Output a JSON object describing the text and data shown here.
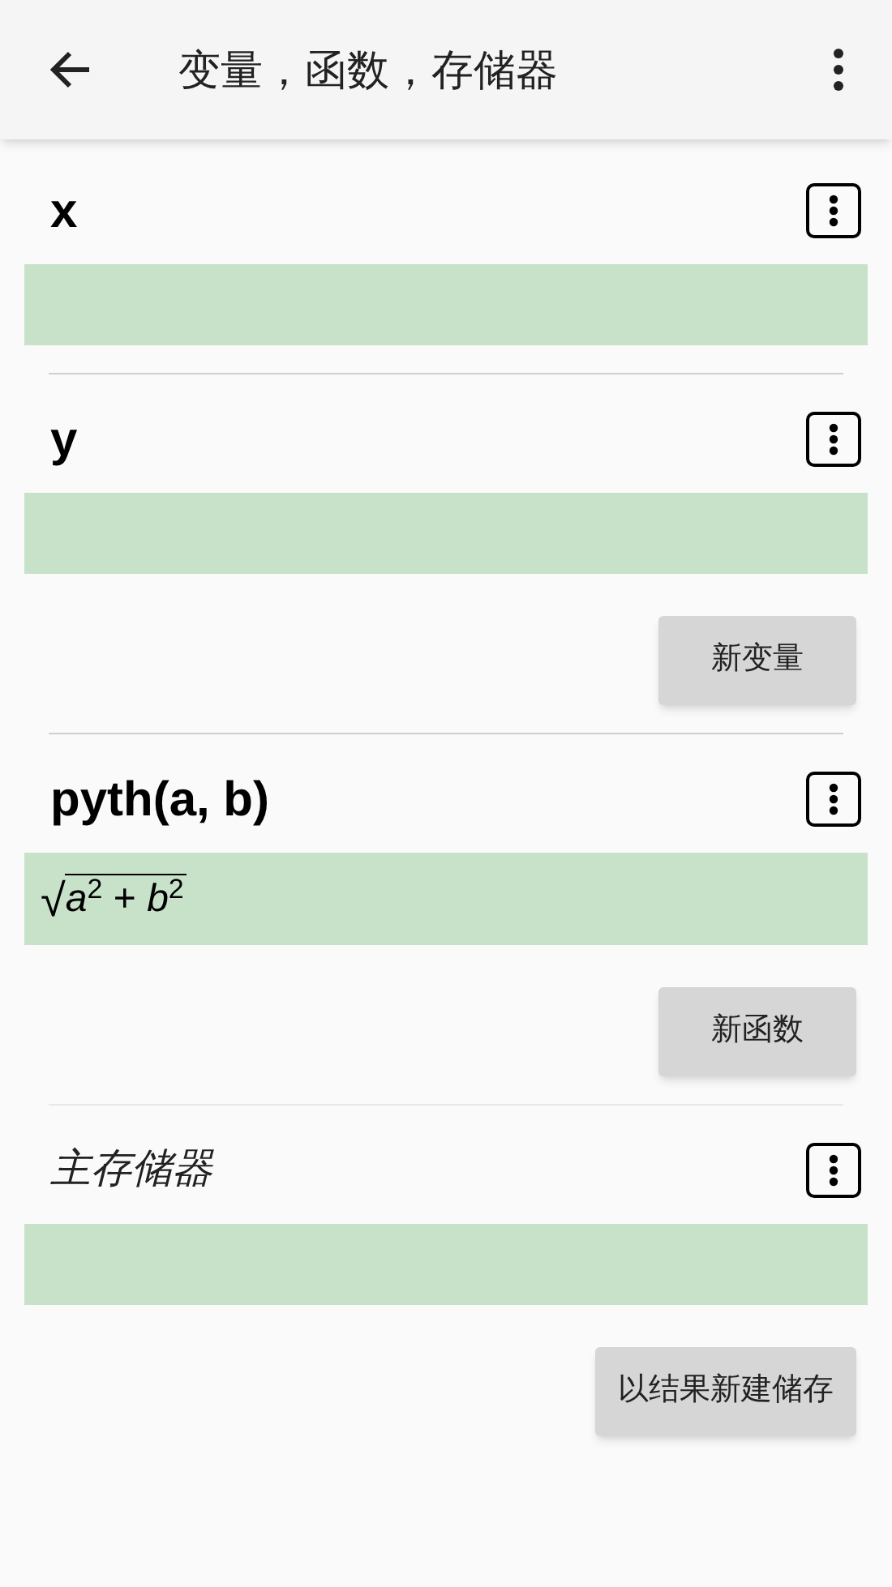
{
  "app_bar": {
    "title": "变量，函数，存储器"
  },
  "sections": [
    {
      "kind": "variables",
      "items": [
        {
          "name": "x"
        },
        {
          "name": "y"
        }
      ],
      "button": "新变量"
    },
    {
      "kind": "functions",
      "items": [
        {
          "name": "pyth(a, b)",
          "formula": {
            "radical": "√",
            "body": "*a*$^{2}$ + *b*$^{2}$"
          }
        }
      ],
      "button": "新函数"
    },
    {
      "kind": "memories",
      "items": [
        {
          "name": "主存储器"
        }
      ],
      "button": "以结果新建储存"
    }
  ]
}
